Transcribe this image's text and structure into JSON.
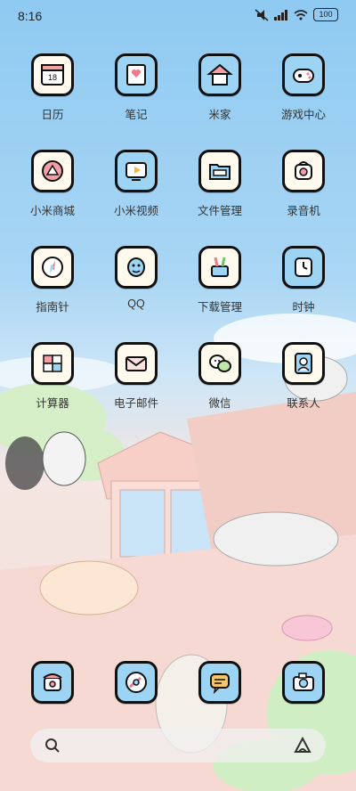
{
  "status": {
    "time": "8:16",
    "battery": "100"
  },
  "apps": [
    {
      "label": "日历"
    },
    {
      "label": "笔记"
    },
    {
      "label": "米家"
    },
    {
      "label": "游戏中心"
    },
    {
      "label": "小米商城"
    },
    {
      "label": "小米视频"
    },
    {
      "label": "文件管理"
    },
    {
      "label": "录音机"
    },
    {
      "label": "指南针"
    },
    {
      "label": "QQ"
    },
    {
      "label": "下载管理"
    },
    {
      "label": "时钟"
    },
    {
      "label": "计算器"
    },
    {
      "label": "电子邮件"
    },
    {
      "label": "微信"
    },
    {
      "label": "联系人"
    }
  ],
  "calendar_day": "18",
  "dock": [
    {
      "icon": "phone-icon"
    },
    {
      "icon": "browser-icon"
    },
    {
      "icon": "messages-icon"
    },
    {
      "icon": "camera-icon"
    }
  ],
  "colors": {
    "tile_border": "#111111",
    "tile_bg": "#fff9ee",
    "tile_blue": "#9dd4f4",
    "sky": "#a9d6f4",
    "roof": "#f2dcd6"
  }
}
